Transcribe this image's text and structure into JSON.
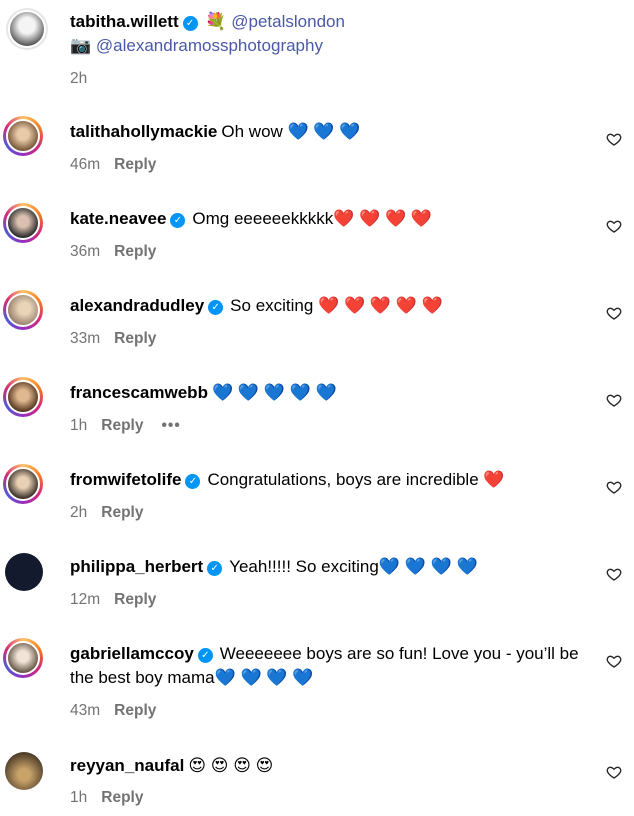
{
  "caption": {
    "user": "tabitha.willett",
    "flower_emoji": "💐",
    "mention1": "@petalslondon",
    "camera_emoji": "📷",
    "mention2": "@alexandramossphotography",
    "time": "2h"
  },
  "reply_label": "Reply",
  "more_label": "•••",
  "comments": [
    {
      "user": "talithahollymackie",
      "verified": false,
      "text": "Oh wow 💙 💙 💙",
      "time": "46m"
    },
    {
      "user": "kate.neavee",
      "verified": true,
      "text": "Omg eeeeeekkkkk❤️ ❤️ ❤️ ❤️",
      "time": "36m"
    },
    {
      "user": "alexandradudley",
      "verified": true,
      "text": "So exciting ❤️ ❤️ ❤️ ❤️ ❤️",
      "time": "33m"
    },
    {
      "user": "francescamwebb",
      "verified": false,
      "text": "💙 💙 💙 💙 💙",
      "time": "1h"
    },
    {
      "user": "fromwifetolife",
      "verified": true,
      "text": "Congratulations, boys are incredible ❤️",
      "time": "2h"
    },
    {
      "user": "philippa_herbert",
      "verified": true,
      "text": "Yeah!!!!! So exciting💙 💙 💙 💙",
      "time": "12m"
    },
    {
      "user": "gabriellamccoy",
      "verified": true,
      "text": "Weeeeeee boys are so fun! Love you - you’ll be the best boy mama💙 💙 💙 💙",
      "time": "43m"
    },
    {
      "user": "reyyan_naufal",
      "verified": false,
      "text": "😍 😍 😍 😍",
      "time": "1h"
    }
  ],
  "colors": {
    "verified": "#0095f6",
    "mention": "#4a59a7",
    "meta": "#737373"
  },
  "icons": {
    "like": "heart-outline-icon",
    "verified": "verified-badge-icon"
  }
}
